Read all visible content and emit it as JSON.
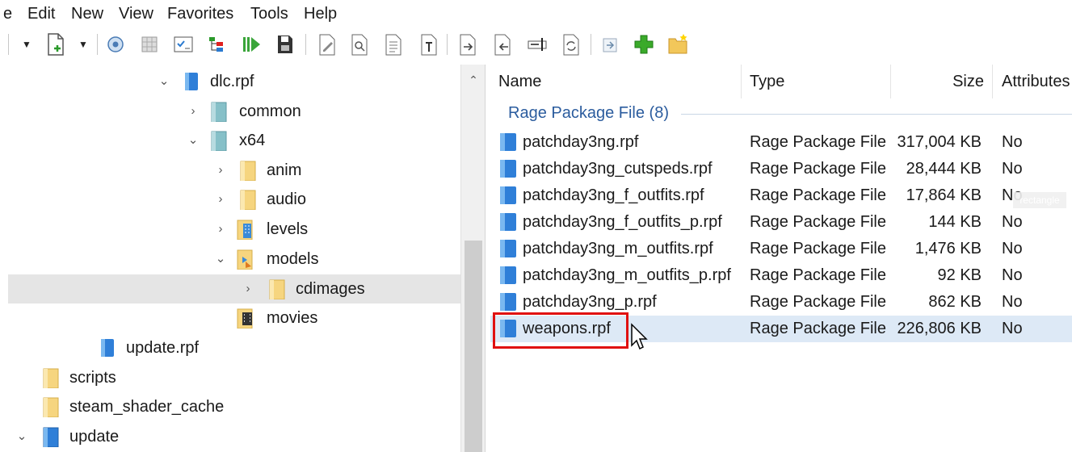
{
  "menu": {
    "items": [
      "e",
      "Edit",
      "New",
      "View",
      "Favorites",
      "Tools",
      "Help"
    ]
  },
  "toolbar": {
    "icons": [
      "new-file-icon",
      "settings-icon",
      "grid-icon",
      "checklist-icon",
      "tree-icon",
      "play-icon",
      "save-icon",
      "edit-document-icon",
      "search-document-icon",
      "text-document-icon",
      "font-document-icon",
      "export-icon",
      "import-icon",
      "rename-icon",
      "refresh-icon",
      "extract-icon",
      "add-icon",
      "new-folder-icon"
    ]
  },
  "tree": {
    "rows": [
      {
        "label": "dlc.rpf",
        "expanded": true,
        "icon": "rpf-archive-icon"
      },
      {
        "label": "common",
        "expanded": false,
        "icon": "teal-folder-icon"
      },
      {
        "label": "x64",
        "expanded": true,
        "icon": "teal-folder-icon"
      },
      {
        "label": "anim",
        "expanded": false,
        "icon": "folder-icon"
      },
      {
        "label": "audio",
        "expanded": false,
        "icon": "folder-icon"
      },
      {
        "label": "levels",
        "expanded": false,
        "icon": "building-folder-icon"
      },
      {
        "label": "models",
        "expanded": true,
        "icon": "models-folder-icon"
      },
      {
        "label": "cdimages",
        "expanded": false,
        "icon": "folder-icon"
      },
      {
        "label": "movies",
        "expanded": null,
        "icon": "film-folder-icon"
      },
      {
        "label": "update.rpf",
        "expanded": null,
        "icon": "rpf-archive-icon"
      },
      {
        "label": "scripts",
        "expanded": null,
        "icon": "folder-icon"
      },
      {
        "label": "steam_shader_cache",
        "expanded": null,
        "icon": "folder-icon"
      },
      {
        "label": "update",
        "expanded": true,
        "icon": "blue-folder-icon"
      }
    ],
    "chevrons": {
      "expanded": "⌄",
      "collapsed": "›"
    }
  },
  "list": {
    "columns": {
      "name": "Name",
      "type": "Type",
      "size": "Size",
      "attributes": "Attributes"
    },
    "group_label": "Rage Package File (8)",
    "files": [
      {
        "name": "patchday3ng.rpf",
        "type": "Rage Package File",
        "size": "317,004 KB",
        "attributes": "No"
      },
      {
        "name": "patchday3ng_cutspeds.rpf",
        "type": "Rage Package File",
        "size": "28,444 KB",
        "attributes": "No"
      },
      {
        "name": "patchday3ng_f_outfits.rpf",
        "type": "Rage Package File",
        "size": "17,864 KB",
        "attributes": "No"
      },
      {
        "name": "patchday3ng_f_outfits_p.rpf",
        "type": "Rage Package File",
        "size": "144 KB",
        "attributes": "No"
      },
      {
        "name": "patchday3ng_m_outfits.rpf",
        "type": "Rage Package File",
        "size": "1,476 KB",
        "attributes": "No"
      },
      {
        "name": "patchday3ng_m_outfits_p.rpf",
        "type": "Rage Package File",
        "size": "92 KB",
        "attributes": "No"
      },
      {
        "name": "patchday3ng_p.rpf",
        "type": "Rage Package File",
        "size": "862 KB",
        "attributes": "No"
      },
      {
        "name": "weapons.rpf",
        "type": "Rage Package File",
        "size": "226,806 KB",
        "attributes": "No"
      }
    ],
    "selected_index": 7
  },
  "overlay": {
    "watermark": "rectangle",
    "highlight_color": "#e01010"
  },
  "colors": {
    "group_text": "#2b5c9e",
    "selected_row": "#dde9f6",
    "tree_selected": "#e5e5e5"
  }
}
